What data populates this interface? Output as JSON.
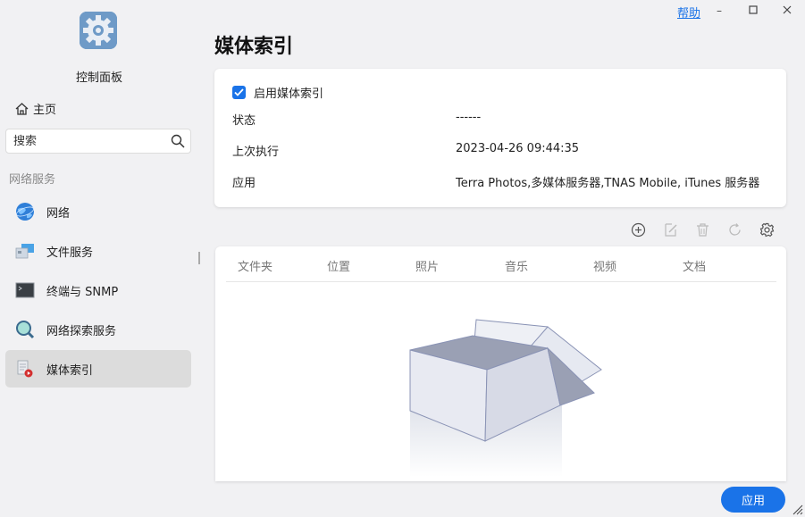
{
  "window": {
    "help_label": "帮助",
    "minimize": "–",
    "maximize": "□",
    "close": "×"
  },
  "sidebar": {
    "app_title": "控制面板",
    "home_label": "主页",
    "search_placeholder": "搜索",
    "section_label": "网络服务",
    "items": [
      {
        "label": "网络",
        "icon": "globe-icon"
      },
      {
        "label": "文件服务",
        "icon": "file-service-icon"
      },
      {
        "label": "终端与 SNMP",
        "icon": "terminal-icon"
      },
      {
        "label": "网络探索服务",
        "icon": "magnifier-icon"
      },
      {
        "label": "媒体索引",
        "icon": "media-index-icon",
        "active": true
      }
    ]
  },
  "main": {
    "title": "媒体索引",
    "settings": {
      "enable_label": "启用媒体索引",
      "enabled": true,
      "rows": [
        {
          "label": "状态",
          "value": "------"
        },
        {
          "label": "上次执行",
          "value": "2023-04-26 09:44:35"
        },
        {
          "label": "应用",
          "value": "Terra Photos,多媒体服务器,TNAS Mobile, iTunes 服务器"
        }
      ]
    },
    "toolbar": [
      "add-icon",
      "edit-icon",
      "delete-icon",
      "refresh-icon",
      "settings-icon"
    ],
    "table": {
      "columns": [
        "文件夹",
        "位置",
        "照片",
        "音乐",
        "视频",
        "文档"
      ],
      "rows": []
    },
    "apply_label": "应用"
  },
  "colors": {
    "accent": "#1a73e8",
    "sidebar_active": "#dcdcdc",
    "background": "#f1f1f3"
  }
}
